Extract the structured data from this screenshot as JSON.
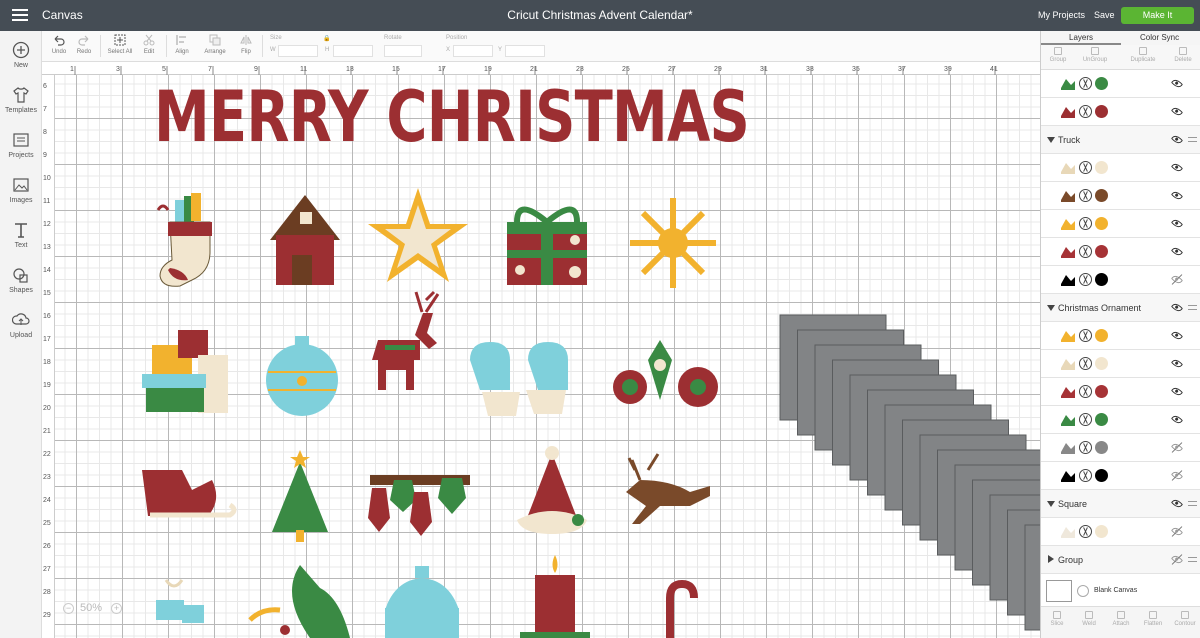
{
  "topbar": {
    "app_name": "Canvas",
    "title": "Cricut Christmas Advent Calendar*",
    "my_projects": "My Projects",
    "save": "Save",
    "make_it": "Make It"
  },
  "sidebar": [
    {
      "icon": "plus-circle-icon",
      "label": "New"
    },
    {
      "icon": "shirt-icon",
      "label": "Templates"
    },
    {
      "icon": "folder-icon",
      "label": "Projects"
    },
    {
      "icon": "image-icon",
      "label": "Images"
    },
    {
      "icon": "text-icon",
      "label": "Text"
    },
    {
      "icon": "shapes-icon",
      "label": "Shapes"
    },
    {
      "icon": "upload-icon",
      "label": "Upload"
    }
  ],
  "toolbar": {
    "undo": "Undo",
    "redo": "Redo",
    "select_all": "Select All",
    "edit": "Edit",
    "align": "Align",
    "arrange": "Arrange",
    "flip": "Flip",
    "size": "Size",
    "w": "W",
    "h": "H",
    "rotate": "Rotate",
    "position": "Position",
    "x": "X",
    "y": "Y"
  },
  "ruler": {
    "h": [
      "1",
      "3",
      "5",
      "7",
      "9",
      "11",
      "13",
      "15",
      "17",
      "19",
      "21",
      "23",
      "25",
      "27",
      "29",
      "31",
      "33",
      "35",
      "37",
      "39",
      "41"
    ],
    "v": [
      "6",
      "7",
      "8",
      "9",
      "10",
      "11",
      "12",
      "13",
      "14",
      "15",
      "16",
      "17",
      "18",
      "19",
      "20",
      "21",
      "22",
      "23",
      "24",
      "25",
      "26",
      "27",
      "28",
      "29"
    ]
  },
  "canvas": {
    "headline": "MERRY CHRISTMAS",
    "zoom": "50%"
  },
  "panel": {
    "tabs": [
      "Layers",
      "Color Sync"
    ],
    "actions": [
      "Group",
      "UnGroup",
      "Duplicate",
      "Delete"
    ],
    "layers": [
      {
        "kind": "layer",
        "color": "#3a8a44",
        "thumb": "#3a8a44",
        "visible": true
      },
      {
        "kind": "layer",
        "color": "#9c2f32",
        "thumb": "#9c2f32",
        "visible": true
      },
      {
        "kind": "group",
        "name": "Truck",
        "open": true
      },
      {
        "kind": "layer",
        "color": "#f2e6cf",
        "thumb": "#e8d8b8",
        "visible": true
      },
      {
        "kind": "layer",
        "color": "#7a4a2a",
        "thumb": "#7a4a2a",
        "visible": true
      },
      {
        "kind": "layer",
        "color": "#f2b22e",
        "thumb": "#f2b22e",
        "visible": true
      },
      {
        "kind": "layer",
        "color": "#a63336",
        "thumb": "#a63336",
        "visible": true
      },
      {
        "kind": "layer",
        "color": "#000000",
        "thumb": "#000000",
        "visible": false
      },
      {
        "kind": "group",
        "name": "Christmas Ornament",
        "open": true
      },
      {
        "kind": "layer",
        "color": "#f2b22e",
        "thumb": "#f2b22e",
        "visible": true
      },
      {
        "kind": "layer",
        "color": "#f2e6cf",
        "thumb": "#e8d8b8",
        "visible": true
      },
      {
        "kind": "layer",
        "color": "#a63336",
        "thumb": "#a63336",
        "visible": true
      },
      {
        "kind": "layer",
        "color": "#3a8a44",
        "thumb": "#3a8a44",
        "visible": true
      },
      {
        "kind": "layer",
        "color": "#888888",
        "thumb": "#888888",
        "visible": false
      },
      {
        "kind": "layer",
        "color": "#000000",
        "thumb": "#000000",
        "visible": false
      },
      {
        "kind": "group",
        "name": "Square",
        "open": true
      },
      {
        "kind": "layer",
        "color": "#f2e6cf",
        "thumb": "#efe8dc",
        "visible": false
      },
      {
        "kind": "group",
        "name": "Group",
        "open": false
      }
    ],
    "blank_canvas": "Blank Canvas",
    "bottom_actions": [
      "Slice",
      "Weld",
      "Attach",
      "Flatten",
      "Contour"
    ]
  },
  "colors": {
    "red": "#9c2f32",
    "green": "#3a8a44",
    "gold": "#f2b22e",
    "cream": "#f2e6cf",
    "brown": "#7a4a2a",
    "aqua": "#7fd0db",
    "gray": "#828486",
    "topbar": "#454d55",
    "make_it": "#5bb533"
  }
}
